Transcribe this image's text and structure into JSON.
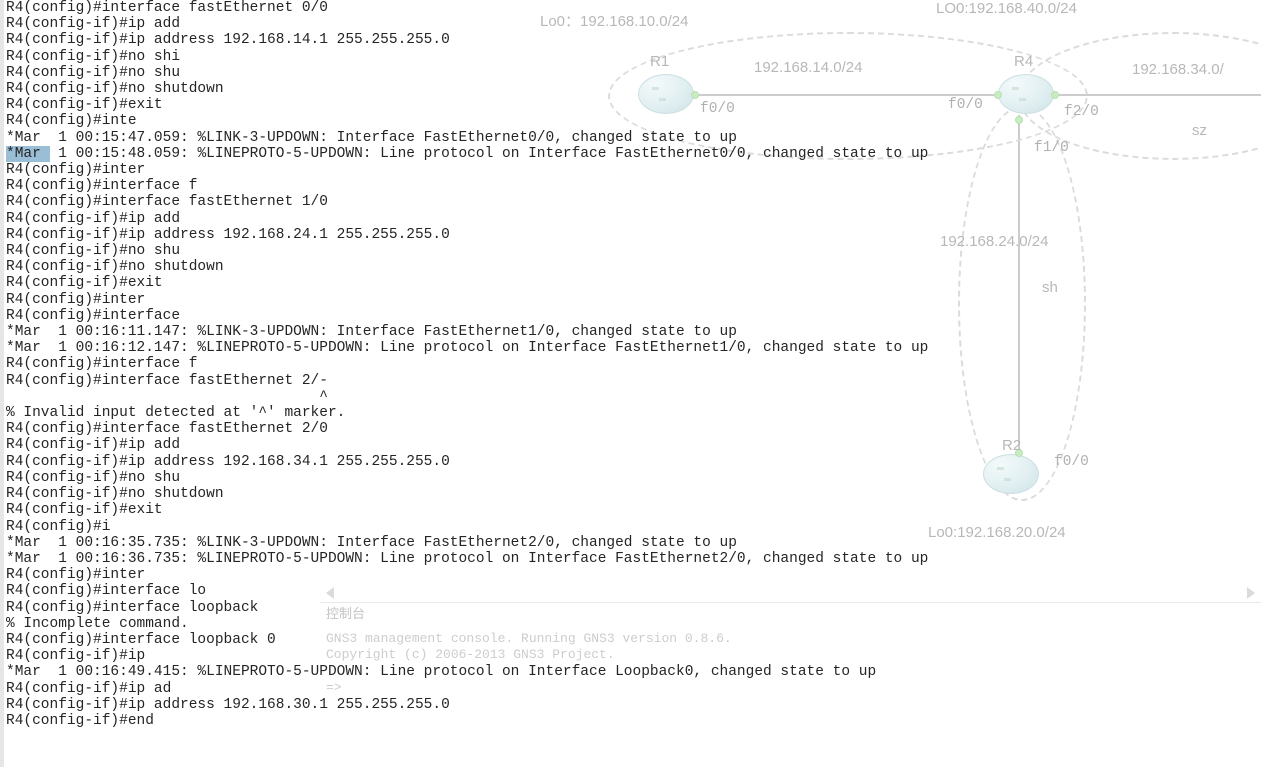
{
  "terminal_lines": [
    "R4(config)#interface fastEthernet 0/0",
    "R4(config-if)#ip add",
    "R4(config-if)#ip address 192.168.14.1 255.255.255.0",
    "R4(config-if)#no shi",
    "R4(config-if)#no shu",
    "R4(config-if)#no shutdown",
    "R4(config-if)#exit",
    "R4(config)#inte",
    "*Mar  1 00:15:47.059: %LINK-3-UPDOWN: Interface FastEthernet0/0, changed state to up",
    "*Mar  1 00:15:48.059: %LINEPROTO-5-UPDOWN: Line protocol on Interface FastEthernet0/0, changed state to up",
    "R4(config)#inter",
    "R4(config)#interface f",
    "R4(config)#interface fastEthernet 1/0",
    "R4(config-if)#ip add",
    "R4(config-if)#ip address 192.168.24.1 255.255.255.0",
    "R4(config-if)#no shu",
    "R4(config-if)#no shutdown",
    "R4(config-if)#exit",
    "R4(config)#inter",
    "R4(config)#interface",
    "*Mar  1 00:16:11.147: %LINK-3-UPDOWN: Interface FastEthernet1/0, changed state to up",
    "*Mar  1 00:16:12.147: %LINEPROTO-5-UPDOWN: Line protocol on Interface FastEthernet1/0, changed state to up",
    "R4(config)#interface f",
    "R4(config)#interface fastEthernet 2/-",
    "                                    ^",
    "% Invalid input detected at '^' marker.",
    "",
    "R4(config)#interface fastEthernet 2/0",
    "R4(config-if)#ip add",
    "R4(config-if)#ip address 192.168.34.1 255.255.255.0",
    "R4(config-if)#no shu",
    "R4(config-if)#no shutdown",
    "R4(config-if)#exit",
    "R4(config)#i",
    "*Mar  1 00:16:35.735: %LINK-3-UPDOWN: Interface FastEthernet2/0, changed state to up",
    "*Mar  1 00:16:36.735: %LINEPROTO-5-UPDOWN: Line protocol on Interface FastEthernet2/0, changed state to up",
    "R4(config)#inter",
    "R4(config)#interface lo",
    "R4(config)#interface loopback",
    "% Incomplete command.",
    "",
    "R4(config)#interface loopback 0",
    "R4(config-if)#ip",
    "*Mar  1 00:16:49.415: %LINEPROTO-5-UPDOWN: Line protocol on Interface Loopback0, changed state to up",
    "R4(config-if)#ip ad",
    "R4(config-if)#ip address 192.168.30.1 255.255.255.0",
    "R4(config-if)#end"
  ],
  "highlighted_line_index": 9,
  "highlight_prefix": "*Mar ",
  "topology": {
    "routers": {
      "r1": {
        "name": "R1"
      },
      "r4": {
        "name": "R4"
      },
      "r2": {
        "name": "R2"
      }
    },
    "loopbacks": {
      "r1_lo0": "Lo0：192.168.10.0/24",
      "r4_lo0": "LO0:192.168.40.0/24",
      "r2_lo0": "Lo0:192.168.20.0/24"
    },
    "nets": {
      "r1_r4": "192.168.14.0/24",
      "r4_r2": "192.168.24.0/24",
      "r4_right": "192.168.34.0/"
    },
    "areas": {
      "right": "sz",
      "bottom": "sh"
    },
    "interfaces": {
      "r1_f00": "f0/0",
      "r4_f00": "f0/0",
      "r4_f20": "f2/0",
      "r4_f10": "f1/0",
      "r2_f00": "f0/0"
    }
  },
  "console_panel": {
    "title": "控制台",
    "lines": [
      "GNS3 management console. Running GNS3 version 0.8.6.",
      "Copyright (c) 2006-2013 GNS3 Project."
    ],
    "prompt": "=>"
  }
}
